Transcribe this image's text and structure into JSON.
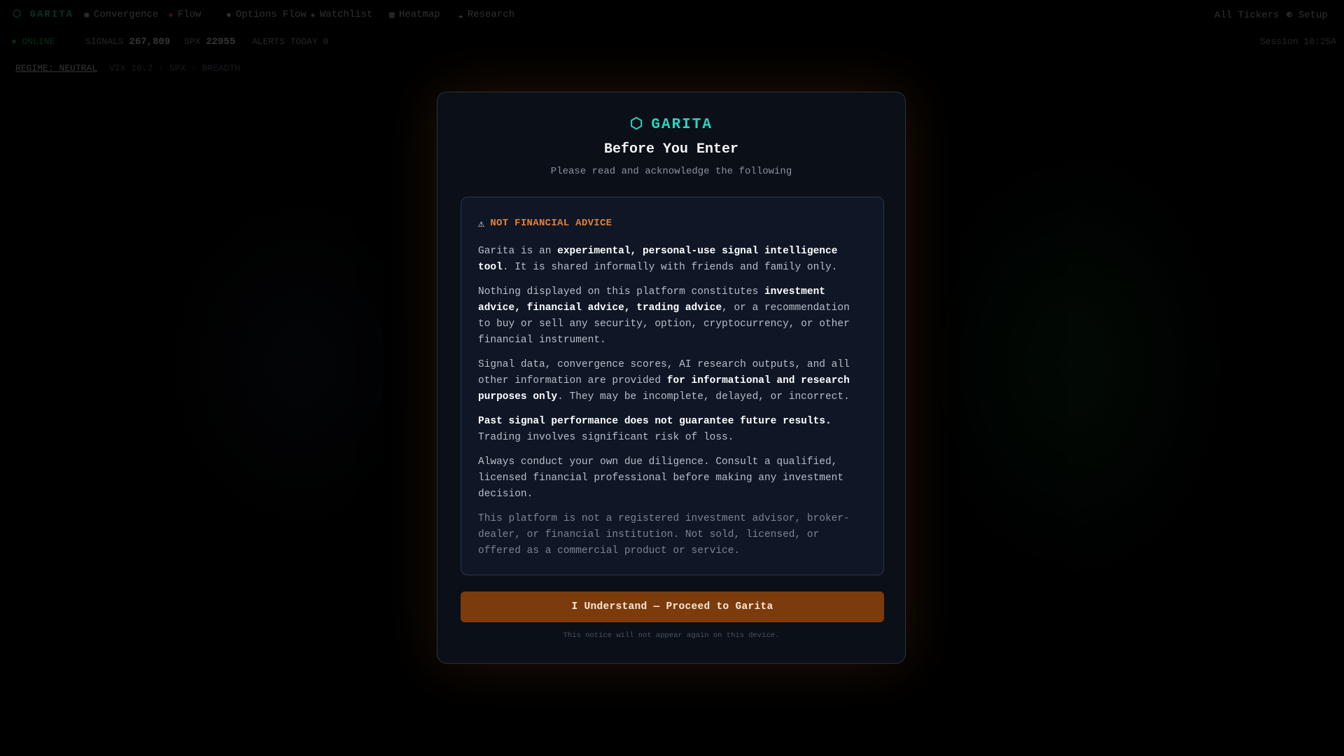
{
  "background": {
    "logo": "⬡ GARITA",
    "nav": [
      {
        "icon": "◉",
        "icon_name": "convergence-icon",
        "label": "Convergence"
      },
      {
        "icon": "●",
        "icon_name": "pulse-dot-icon",
        "label": "Flow"
      },
      {
        "icon": "●",
        "icon_name": "dot-icon",
        "label": "Options Flow"
      },
      {
        "icon": "★",
        "icon_name": "star-icon",
        "label": "Watchlist"
      },
      {
        "icon": "▦",
        "icon_name": "grid-icon",
        "label": "Heatmap"
      },
      {
        "icon": "☁",
        "icon_name": "cloud-icon",
        "label": "Research"
      }
    ],
    "nav_right": [
      {
        "label": "All Tickers ▾"
      },
      {
        "label": "⚙ Setup"
      }
    ],
    "status": {
      "online": "● ONLINE",
      "signals_label": "SIGNALS",
      "signals_value": "267,809",
      "spx_label": "SPX",
      "spx_value": "22955",
      "alerts_label": "ALERTS TODAY 0",
      "right": "Session 10:25A"
    },
    "regime": {
      "label": "REGIME: NEUTRAL",
      "extra": "VIX 16.2 · SPX · BREADTH"
    }
  },
  "modal": {
    "brand_icon": "⬡",
    "brand": "GARITA",
    "title": "Before You Enter",
    "subtitle": "Please read and acknowledge the following",
    "notice": {
      "warn_icon": "⚠",
      "heading": "NOT FINANCIAL ADVICE",
      "p1_a": "Garita is an ",
      "p1_b": "experimental, personal-use signal intelligence tool",
      "p1_c": ". It is shared informally with friends and family only.",
      "p2_a": "Nothing displayed on this platform constitutes ",
      "p2_b": "investment advice, financial advice, trading advice",
      "p2_c": ", or a recommendation to buy or sell any security, option, cryptocurrency, or other financial instrument.",
      "p3_a": "Signal data, convergence scores, AI research outputs, and all other information are provided ",
      "p3_b": "for informational and research purposes only",
      "p3_c": ". They may be incomplete, delayed, or incorrect.",
      "p4_a": "Past signal performance does not guarantee future results.",
      "p4_b": " Trading involves significant risk of loss.",
      "p5": "Always conduct your own due diligence. Consult a qualified, licensed financial professional before making any investment decision.",
      "p6": "This platform is not a registered investment advisor, broker-dealer, or financial institution. Not sold, licensed, or offered as a commercial product or service."
    },
    "cta": "I Understand — Proceed to Garita",
    "footnote": "This notice will not appear again on this device.",
    "colors": {
      "brand": "#2dd4bf",
      "warning": "#e0823a",
      "cta_bg": "#7c3b0c"
    }
  }
}
